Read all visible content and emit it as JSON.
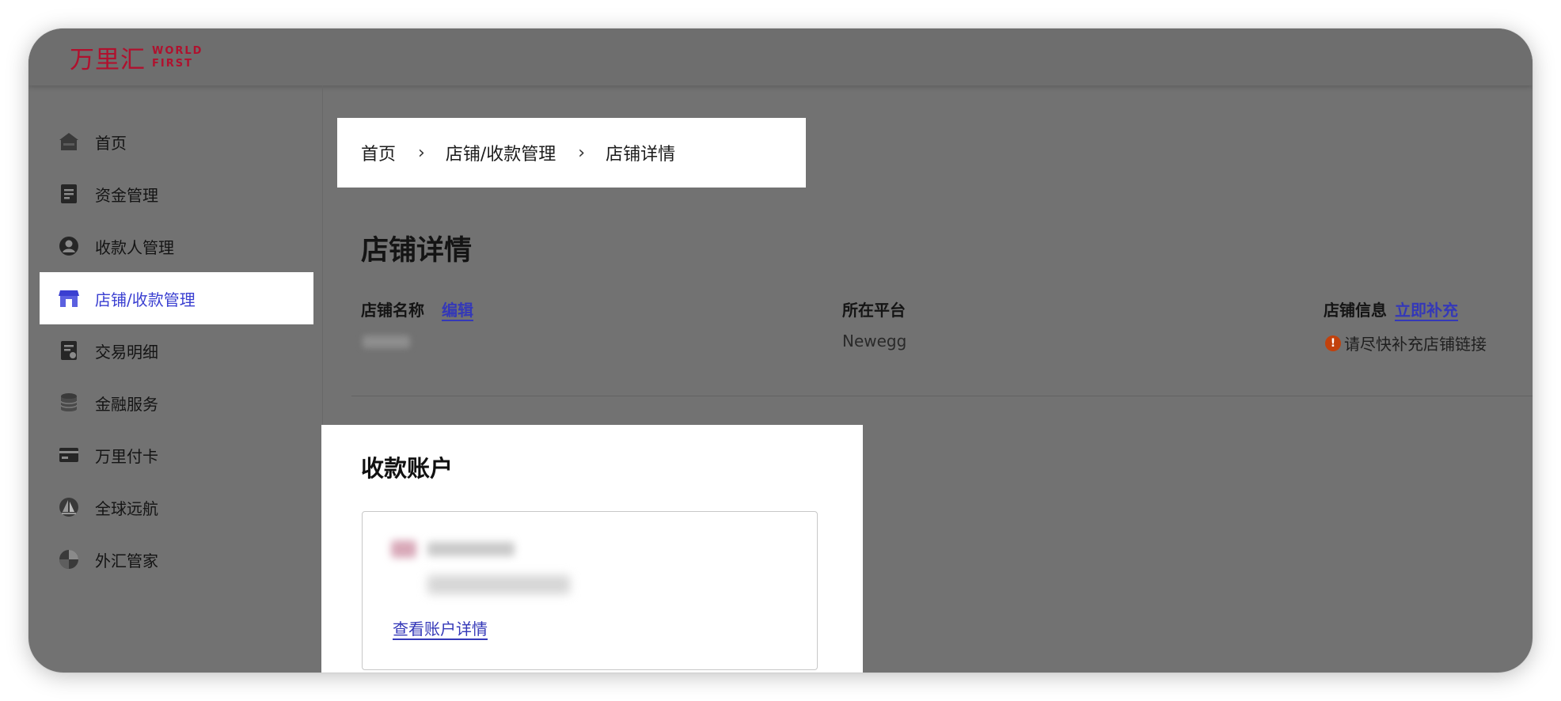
{
  "logo": {
    "cn": "万里汇",
    "en_line1": "WORLD",
    "en_line2": "FIRST",
    "color": "#b0112e"
  },
  "sidebar": {
    "items": [
      {
        "label": "首页",
        "icon": "home-icon"
      },
      {
        "label": "资金管理",
        "icon": "document-icon"
      },
      {
        "label": "收款人管理",
        "icon": "user-icon"
      },
      {
        "label": "店铺/收款管理",
        "icon": "store-icon",
        "active": true
      },
      {
        "label": "交易明细",
        "icon": "receipt-icon"
      },
      {
        "label": "金融服务",
        "icon": "coins-icon"
      },
      {
        "label": "万里付卡",
        "icon": "card-icon"
      },
      {
        "label": "全球远航",
        "icon": "sailboat-icon"
      },
      {
        "label": "外汇管家",
        "icon": "globe-icon"
      }
    ],
    "active_color": "#3a3fd1"
  },
  "breadcrumb": {
    "items": [
      "首页",
      "店铺/收款管理",
      "店铺详情"
    ],
    "separator": "›"
  },
  "page": {
    "title": "店铺详情",
    "fields": {
      "store_name": {
        "label": "店铺名称",
        "action": "编辑"
      },
      "platform": {
        "label": "所在平台",
        "value": "Newegg"
      },
      "store_info": {
        "label": "店铺信息",
        "action": "立即补充",
        "warning": "请尽快补充店铺链接",
        "warning_icon": "!"
      }
    }
  },
  "account": {
    "title": "收款账户",
    "view_details": "查看账户详情"
  },
  "colors": {
    "link": "#3438b8",
    "warning": "#c2410c"
  }
}
